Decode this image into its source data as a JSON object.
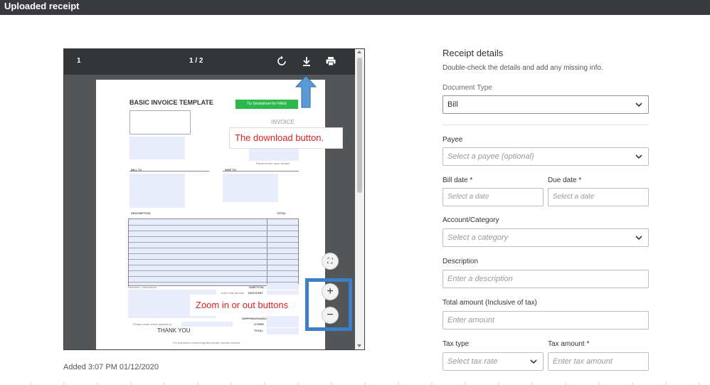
{
  "header": {
    "title": "Uploaded receipt"
  },
  "viewer": {
    "page_left": "1",
    "page_count": "1 / 2",
    "icons": [
      "rotate-icon",
      "download-icon",
      "print-icon"
    ],
    "fit_label": "⛶",
    "zoom_in": "+",
    "zoom_out": "−",
    "document": {
      "title": "BASIC INVOICE TEMPLATE",
      "button": "Try Smartsheet for FREE",
      "invoice_label": "INVOICE",
      "payment_note": "Payment due upon receipt.",
      "bill_to": "BILL TO",
      "ship_to": "SHIP TO",
      "description": "DESCRIPTION",
      "total": "TOTAL",
      "remarks": "Remarks / Instructions:",
      "subtotal": "SUBTOTAL",
      "discount_note": "enter total amount",
      "discount": "DISCOUNT",
      "shipping": "SHIPPING/HANDLING",
      "check_note": "Please make check payable to",
      "other": "OTHER",
      "thank_you": "THANK YOU",
      "total2": "TOTAL",
      "questions": "For questions concerning this invoice, please contact"
    }
  },
  "annotations": {
    "download": "The download button.",
    "zoom": "Zoom in or out buttons",
    "accent": "#3a7fc8",
    "text_color": "#e02020"
  },
  "added": "Added 3:07 PM 01/12/2020",
  "form": {
    "title": "Receipt details",
    "subtitle": "Double-check the details and add any missing info.",
    "doc_type_label": "Document Type",
    "doc_type_value": "Bill",
    "payee_label": "Payee",
    "payee_placeholder": "Select a payee (optional)",
    "bill_date_label": "Bill date *",
    "bill_date_placeholder": "Select a date",
    "due_date_label": "Due date *",
    "due_date_placeholder": "Select a date",
    "account_label": "Account/Category",
    "account_placeholder": "Select a category",
    "description_label": "Description",
    "description_placeholder": "Enter a description",
    "total_label": "Total amount (Inclusive of tax)",
    "total_placeholder": "Enter amount",
    "tax_type_label": "Tax type",
    "tax_type_placeholder": "Select tax rate",
    "tax_amount_label": "Tax amount *",
    "tax_amount_placeholder": "Enter tax amount"
  }
}
